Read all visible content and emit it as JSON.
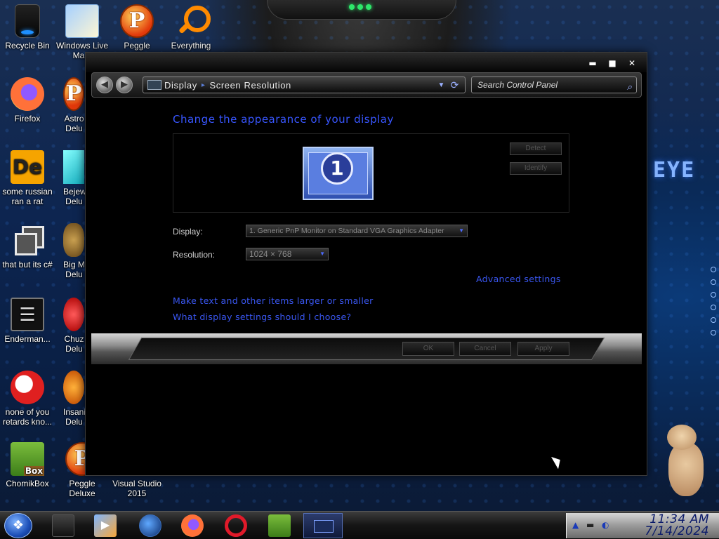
{
  "desktop": {
    "icons": [
      {
        "label": "Recycle Bin",
        "icon": "recycle-bin-icon"
      },
      {
        "label": "Windows Live Ma...",
        "icon": "windows-live-mail-icon"
      },
      {
        "label": "Peggle",
        "icon": "peggle-icon"
      },
      {
        "label": "Everything",
        "icon": "everything-search-icon"
      },
      {
        "label": "Firefox",
        "icon": "firefox-icon"
      },
      {
        "label": "Astro Delu",
        "icon": "astro-game-icon"
      },
      {
        "label": "some russian ran a rat",
        "icon": "de-app-icon"
      },
      {
        "label": "Bejew Delu",
        "icon": "bejeweled-icon"
      },
      {
        "label": "that but its c#",
        "icon": "copy-icon"
      },
      {
        "label": "Big M Delu",
        "icon": "big-money-icon"
      },
      {
        "label": "Enderman...",
        "icon": "enderman-icon"
      },
      {
        "label": "Chuz Delu",
        "icon": "chuzzle-icon"
      },
      {
        "label": "none of you retards kno...",
        "icon": "red-bird-icon"
      },
      {
        "label": "Insaniq Delu",
        "icon": "insaniquarium-icon"
      },
      {
        "label": "ChomikBox",
        "icon": "chomikbox-icon"
      },
      {
        "label": "Peggle Deluxe",
        "icon": "peggle-deluxe-icon"
      },
      {
        "label": "Visual Studio 2015",
        "icon": "visual-studio-icon"
      }
    ],
    "wallpaper_text": "EYE"
  },
  "window": {
    "breadcrumb": [
      "Display",
      "Screen Resolution"
    ],
    "search_placeholder": "Search Control Panel",
    "heading": "Change the appearance of your display",
    "monitor_number": "1",
    "detect_label": "Detect",
    "identify_label": "Identify",
    "display_label": "Display:",
    "display_value": "1. Generic PnP Monitor on Standard VGA Graphics Adapter",
    "resolution_label": "Resolution:",
    "resolution_value": "1024 × 768",
    "advanced_link": "Advanced settings",
    "link_text_size": "Make text and other items larger or smaller",
    "link_which_settings": "What display settings should I choose?",
    "ok_label": "OK",
    "cancel_label": "Cancel",
    "apply_label": "Apply"
  },
  "taskbar": {
    "time": "11:34 AM",
    "date": "7/14/2024"
  },
  "colors": {
    "accent_link": "#3a57f2",
    "heading": "#3856ff",
    "window_bg": "#000000"
  }
}
